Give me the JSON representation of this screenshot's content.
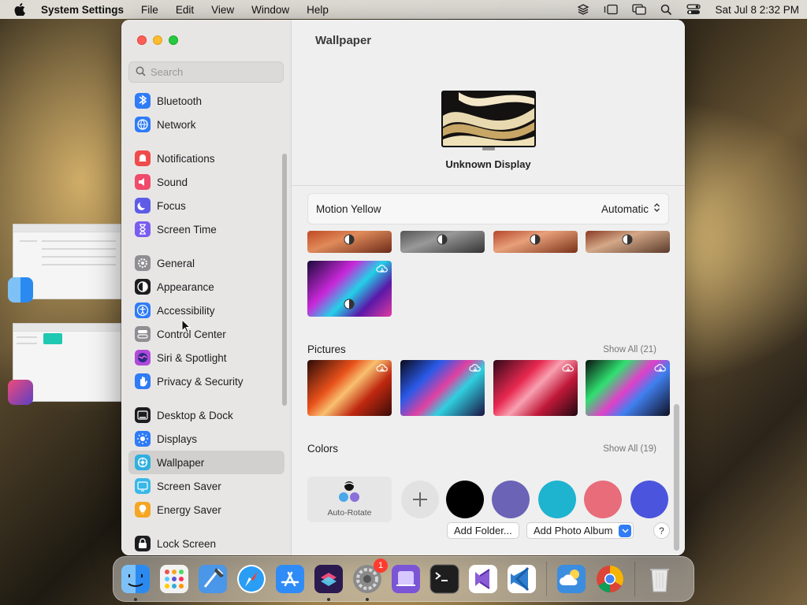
{
  "menubar": {
    "app_name": "System Settings",
    "menus": [
      "File",
      "Edit",
      "View",
      "Window",
      "Help"
    ],
    "clock": "Sat Jul 8  2:32 PM"
  },
  "sidebar": {
    "search_placeholder": "Search",
    "groups": [
      [
        {
          "label": "Bluetooth",
          "icon": "bluetooth-icon",
          "color": "#2f7cf6"
        },
        {
          "label": "Network",
          "icon": "globe-icon",
          "color": "#2f7cf6"
        }
      ],
      [
        {
          "label": "Notifications",
          "icon": "bell-icon",
          "color": "#f04b4b"
        },
        {
          "label": "Sound",
          "icon": "speaker-icon",
          "color": "#f04b6a"
        },
        {
          "label": "Focus",
          "icon": "moon-icon",
          "color": "#5e5ce6"
        },
        {
          "label": "Screen Time",
          "icon": "hourglass-icon",
          "color": "#7a5cf0"
        }
      ],
      [
        {
          "label": "General",
          "icon": "gear-icon",
          "color": "#8e8e93"
        },
        {
          "label": "Appearance",
          "icon": "appearance-icon",
          "color": "#1d1d1f"
        },
        {
          "label": "Accessibility",
          "icon": "accessibility-icon",
          "color": "#2f7cf6"
        },
        {
          "label": "Control Center",
          "icon": "control-center-icon",
          "color": "#8e8e93"
        },
        {
          "label": "Siri & Spotlight",
          "icon": "siri-icon",
          "color": "#b04ad8"
        },
        {
          "label": "Privacy & Security",
          "icon": "hand-icon",
          "color": "#2f7cf6"
        }
      ],
      [
        {
          "label": "Desktop & Dock",
          "icon": "dock-icon",
          "color": "#1d1d1f"
        },
        {
          "label": "Displays",
          "icon": "sun-icon",
          "color": "#2f7cf6"
        },
        {
          "label": "Wallpaper",
          "icon": "wallpaper-icon",
          "color": "#30b0e0",
          "selected": true
        },
        {
          "label": "Screen Saver",
          "icon": "screen-saver-icon",
          "color": "#38b8e8"
        },
        {
          "label": "Energy Saver",
          "icon": "bulb-icon",
          "color": "#f5a623"
        }
      ],
      [
        {
          "label": "Lock Screen",
          "icon": "lock-icon",
          "color": "#1d1d1f"
        }
      ]
    ]
  },
  "main": {
    "title": "Wallpaper",
    "display_name": "Unknown Display",
    "selected_wallpaper": "Motion Yellow",
    "mode": "Automatic",
    "pictures": {
      "title": "Pictures",
      "show_all": "Show All (21)"
    },
    "colors": {
      "title": "Colors",
      "show_all": "Show All (19)",
      "auto_rotate": "Auto-Rotate",
      "swatches": [
        "#000000",
        "#6b63b5",
        "#1eb3cf",
        "#e86c7a",
        "#4a54dc"
      ]
    },
    "buttons": {
      "add_folder": "Add Folder...",
      "add_photo_album": "Add Photo Album",
      "help": "?"
    }
  },
  "dock": {
    "apps": [
      {
        "name": "finder",
        "color": "#3a8ef0",
        "running": true
      },
      {
        "name": "launchpad",
        "color": "#e8e8e8"
      },
      {
        "name": "xcode",
        "color": "#3b86e0"
      },
      {
        "name": "safari",
        "color": "#2a9df4"
      },
      {
        "name": "app-store",
        "color": "#2f8cf7"
      },
      {
        "name": "shortcuts",
        "color": "#5a3fc0",
        "running": true
      },
      {
        "name": "system-settings",
        "color": "#8a8a8a",
        "badge": "1",
        "running": true
      },
      {
        "name": "simulator",
        "color": "#7b55d6"
      },
      {
        "name": "terminal",
        "color": "#1e1e1e"
      },
      {
        "name": "visual-studio",
        "color": "#8a5cd8"
      },
      {
        "name": "vscode",
        "color": "#2f7fd0"
      },
      {
        "name": "weather",
        "color": "#3b8de0"
      },
      {
        "name": "chrome",
        "color": "#ffffff"
      },
      {
        "name": "trash",
        "color": "#dcdcdc"
      }
    ]
  }
}
